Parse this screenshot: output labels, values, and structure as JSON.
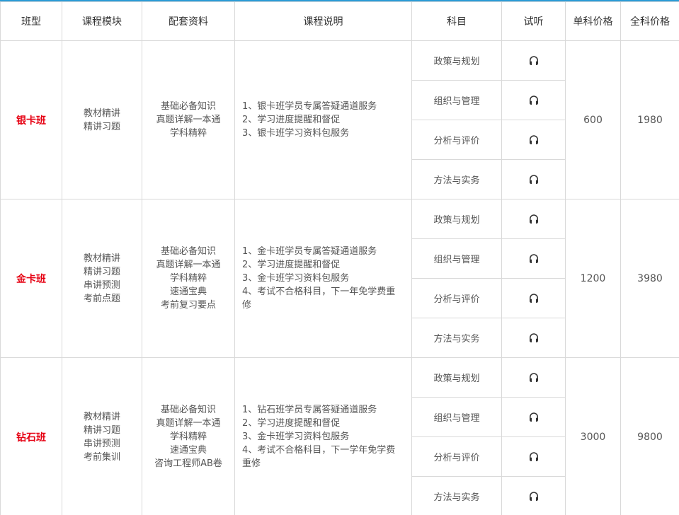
{
  "headers": [
    "班型",
    "课程模块",
    "配套资料",
    "课程说明",
    "科目",
    "试听",
    "单科价格",
    "全科价格"
  ],
  "listen_icon": "headphones-icon",
  "colors": {
    "accent": "#2a9bd6",
    "tier_name": "#e60012",
    "border": "#d9d9d9"
  },
  "tiers": [
    {
      "name": "银卡班",
      "modules": [
        "教材精讲",
        "精讲习题"
      ],
      "materials": [
        "基础必备知识",
        "真题详解一本通",
        "学科精粹"
      ],
      "description": [
        "1、银卡班学员专属答疑通道服务",
        "2、学习进度提醒和督促",
        "3、银卡班学习资料包服务"
      ],
      "subjects": [
        "政策与规划",
        "组织与管理",
        "分析与评价",
        "方法与实务"
      ],
      "single_price": "600",
      "full_price": "1980"
    },
    {
      "name": "金卡班",
      "modules": [
        "教材精讲",
        "精讲习题",
        "串讲预测",
        "考前点题"
      ],
      "materials": [
        "基础必备知识",
        "真题详解一本通",
        "学科精粹",
        "速通宝典",
        "考前复习要点"
      ],
      "description": [
        "1、金卡班学员专属答疑通道服务",
        "2、学习进度提醒和督促",
        "3、金卡班学习资料包服务",
        "4、考试不合格科目，下一年免学费重修"
      ],
      "subjects": [
        "政策与规划",
        "组织与管理",
        "分析与评价",
        "方法与实务"
      ],
      "single_price": "1200",
      "full_price": "3980"
    },
    {
      "name": "钻石班",
      "modules": [
        "教材精讲",
        "精讲习题",
        "串讲预测",
        "考前集训"
      ],
      "materials": [
        "基础必备知识",
        "真题详解一本通",
        "学科精粹",
        "速通宝典",
        "咨询工程师AB卷"
      ],
      "description": [
        "1、钻石班学员专属答疑通道服务",
        "2、学习进度提醒和督促",
        "3、金卡班学习资料包服务",
        "4、考试不合格科目，下一学年免学费重修"
      ],
      "subjects": [
        "政策与规划",
        "组织与管理",
        "分析与评价",
        "方法与实务"
      ],
      "single_price": "3000",
      "full_price": "9800"
    }
  ]
}
